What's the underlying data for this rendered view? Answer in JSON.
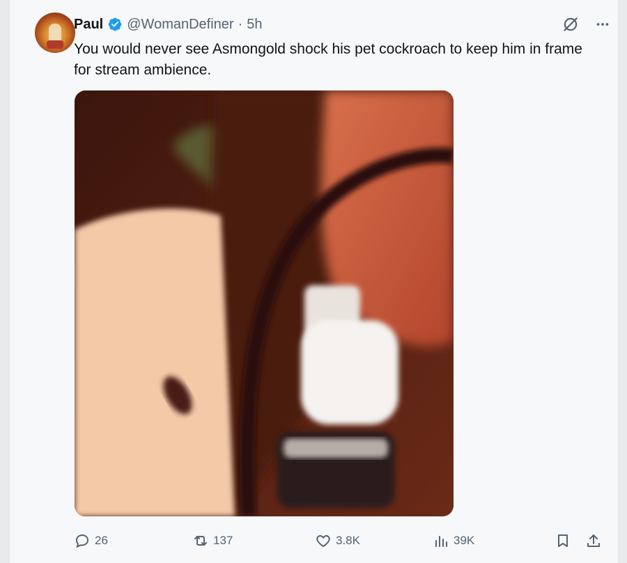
{
  "author": {
    "name": "Paul",
    "handle": "@WomanDefiner",
    "separator": "·",
    "time": "5h",
    "verified_icon": "verified-badge-icon"
  },
  "tweet": {
    "text": "You would never see Asmongold shock his pet cockroach to keep him in frame for stream ambience."
  },
  "icons": {
    "grok": "grok-icon",
    "more": "more-icon"
  },
  "actions": {
    "reply_count": "26",
    "retweet_count": "137",
    "like_count": "3.8K",
    "views_count": "39K"
  },
  "colors": {
    "verified": "#1d9bf0",
    "secondary_text": "#536471",
    "primary_text": "#0f1419",
    "card_bg": "#f7f8fa"
  }
}
